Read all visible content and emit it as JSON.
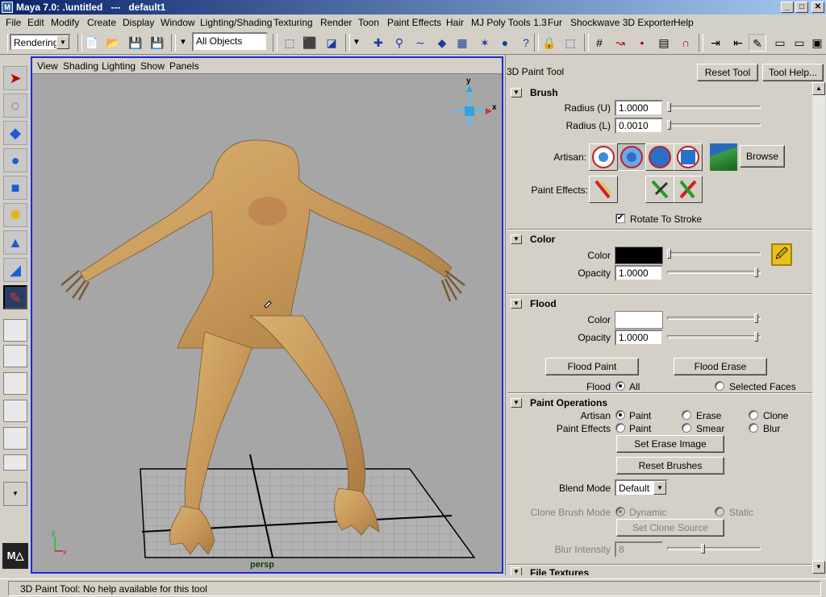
{
  "window": {
    "title": "Maya 7.0: .\\untitled   ---   default1",
    "minimize": "_",
    "maximize": "□",
    "close": "✕"
  },
  "menubar": [
    "File",
    "Edit",
    "Modify",
    "Create",
    "Display",
    "Window",
    "Lighting/Shading",
    "Texturing",
    "Render",
    "Toon",
    "Paint Effects",
    "Hair",
    "MJ Poly Tools 1.3",
    "Fur",
    "Shockwave 3D Exporter",
    "Help"
  ],
  "statusline": {
    "menu_set": "Rendering",
    "selection_mask": "All Objects"
  },
  "viewport": {
    "menu": [
      "View",
      "Shading",
      "Lighting",
      "Show",
      "Panels"
    ],
    "camera_label": "persp",
    "axis_y": "y",
    "axis_x": "x"
  },
  "panel": {
    "title": "3D Paint Tool",
    "reset_tool": "Reset Tool",
    "tool_help": "Tool Help...",
    "brush": {
      "header": "Brush",
      "radius_u_label": "Radius (U)",
      "radius_u": "1.0000",
      "radius_l_label": "Radius (L)",
      "radius_l": "0.0010",
      "artisan_label": "Artisan:",
      "browse": "Browse",
      "paint_effects_label": "Paint Effects:",
      "rotate_to_stroke": "Rotate To Stroke"
    },
    "color": {
      "header": "Color",
      "color_label": "Color",
      "color_value": "#000000",
      "opacity_label": "Opacity",
      "opacity": "1.0000"
    },
    "flood": {
      "header": "Flood",
      "color_label": "Color",
      "color_value": "#ffffff",
      "opacity_label": "Opacity",
      "opacity": "1.0000",
      "flood_paint": "Flood Paint",
      "flood_erase": "Flood Erase",
      "flood_label": "Flood",
      "all": "All",
      "selected_faces": "Selected Faces"
    },
    "paint_ops": {
      "header": "Paint Operations",
      "artisan_label": "Artisan",
      "paint": "Paint",
      "erase": "Erase",
      "clone": "Clone",
      "paint_effects_label": "Paint Effects",
      "pe_paint": "Paint",
      "smear": "Smear",
      "blur": "Blur",
      "set_erase_image": "Set Erase Image",
      "reset_brushes": "Reset Brushes",
      "blend_mode_label": "Blend Mode",
      "blend_mode": "Default",
      "clone_brush_mode_label": "Clone Brush Mode",
      "dynamic": "Dynamic",
      "static": "Static",
      "set_clone_source": "Set Clone Source",
      "blur_intensity_label": "Blur Intensity",
      "blur_intensity": "8"
    },
    "file_textures": {
      "header": "File Textures"
    }
  },
  "helpline": "3D Paint Tool: No help available for this tool"
}
